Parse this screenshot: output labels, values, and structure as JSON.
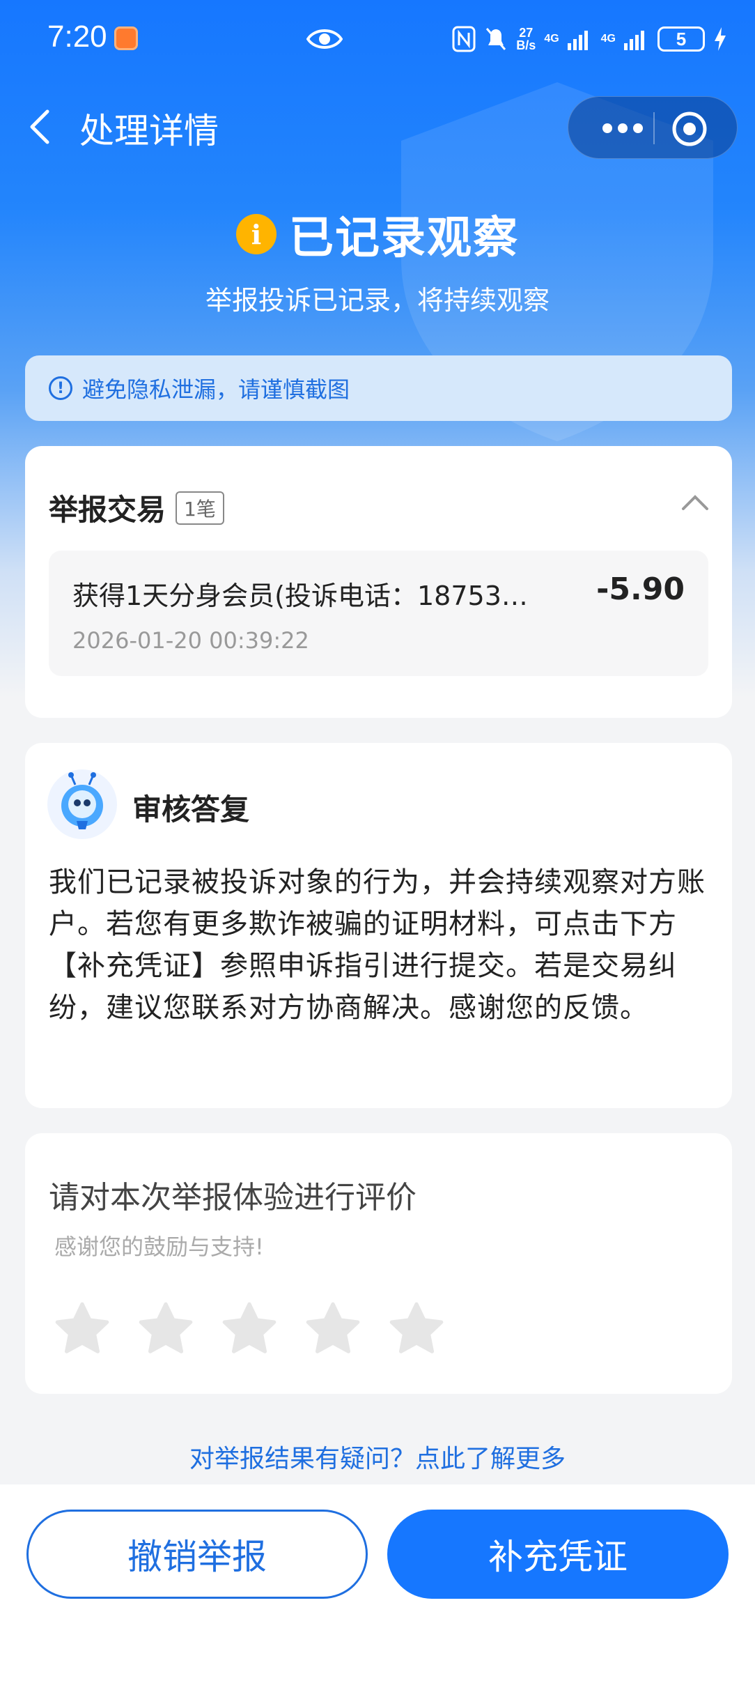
{
  "status_bar": {
    "time": "7:20",
    "net_speed_value": "27",
    "net_speed_unit": "B/s",
    "sim1": "4G",
    "sim2": "4G",
    "battery": "5"
  },
  "nav": {
    "title": "处理详情"
  },
  "status": {
    "title": "已记录观察",
    "subtitle": "举报投诉已记录，将持续观察",
    "icon_char": "i"
  },
  "notice": {
    "icon_char": "!",
    "text": "避免隐私泄漏，请谨慎截图"
  },
  "transactions": {
    "title": "举报交易",
    "count_badge": "1笔",
    "items": [
      {
        "name": "获得1天分身会员(投诉电话：18753…",
        "amount": "-5.90",
        "time": "2026-01-20 00:39:22"
      }
    ]
  },
  "reply": {
    "title": "审核答复",
    "text": "我们已记录被投诉对象的行为，并会持续观察对方账户。若您有更多欺诈被骗的证明材料，可点击下方【补充凭证】参照申诉指引进行提交。若是交易纠纷，建议您联系对方协商解决。感谢您的反馈。"
  },
  "rating": {
    "title": "请对本次举报体验进行评价",
    "subtitle": "感谢您的鼓励与支持!",
    "max_stars": 5,
    "selected_stars": 0
  },
  "help_link": "对举报结果有疑问？点此了解更多",
  "actions": {
    "cancel_label": "撤销举报",
    "supplement_label": "补充凭证"
  },
  "colors": {
    "primary": "#1677ff",
    "warning": "#ffb400",
    "link": "#1f6fe0",
    "star_empty": "#e6e6e6"
  }
}
